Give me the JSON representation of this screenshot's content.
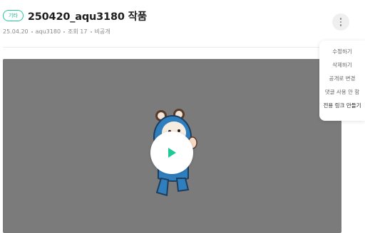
{
  "post": {
    "category": "기타",
    "title": "250420_aqu3180 작품",
    "date": "25.04.20",
    "author": "aqu3180",
    "views": "조회 17",
    "visibility": "비공개"
  },
  "more_menu": {
    "icon": "more-vertical-icon",
    "items": [
      {
        "label": "수정하기"
      },
      {
        "label": "삭제하기"
      },
      {
        "label": "공개로 변경"
      },
      {
        "label": "댓글 사용 안 함"
      },
      {
        "label": "전용 링크 만들기"
      }
    ]
  },
  "video": {
    "play_icon": "play-icon",
    "background": "#7b7b7b",
    "accent": "#1fc997"
  }
}
